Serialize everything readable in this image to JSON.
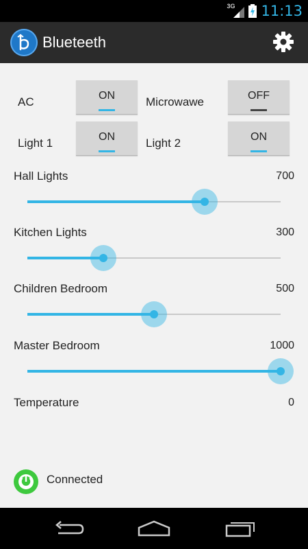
{
  "status_bar": {
    "network": "3G",
    "time": "11:13",
    "icons": [
      "signal-icon",
      "battery-charging-icon"
    ]
  },
  "action_bar": {
    "app_name": "Blueteeth",
    "app_icon": "bluetooth-b-icon",
    "settings_icon": "gear-icon"
  },
  "toggles": [
    {
      "label": "AC",
      "state": "ON"
    },
    {
      "label": "Microwawe",
      "state": "OFF"
    },
    {
      "label": "Light 1",
      "state": "ON"
    },
    {
      "label": "Light 2",
      "state": "ON"
    }
  ],
  "sliders": [
    {
      "label": "Hall Lights",
      "value": "700",
      "level": 0.7
    },
    {
      "label": "Kitchen Lights",
      "value": "300",
      "level": 0.3
    },
    {
      "label": "Children Bedroom",
      "value": "500",
      "level": 0.5
    },
    {
      "label": "Master Bedroom",
      "value": "1000",
      "level": 1.0
    }
  ],
  "temperature": {
    "label": "Temperature",
    "value": "0"
  },
  "connection": {
    "icon": "power-icon",
    "text": "Connected",
    "color": "#3ec93e"
  },
  "nav_bar": {
    "buttons": [
      "back-icon",
      "home-icon",
      "recent-apps-icon"
    ]
  },
  "colors": {
    "accent": "#33b5e5",
    "action_bar": "#2b2b2b",
    "background": "#f2f2f2"
  }
}
